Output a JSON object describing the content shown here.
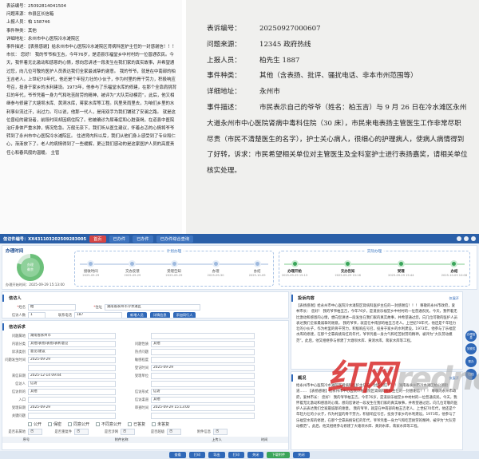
{
  "doc1": {
    "lines": [
      {
        "k": "表诉编号：",
        "v": "25092814041504"
      },
      {
        "k": "问题来源：",
        "v": "市县区长信箱"
      },
      {
        "k": "上报人员：",
        "v": "柏        158746"
      },
      {
        "k": "事件种类：",
        "v": "其他"
      },
      {
        "k": "详细地址：",
        "v": "永州市中心医院冷水滩院区"
      },
      {
        "k": "事件描述：",
        "v": "【表扬感谢】给永州市中心医院冷水滩院区肾病科医护主任的一封感谢信！！！  尊敬的永州市政府，爱林"
      }
    ],
    "body": "市长：   您好！   我的爷爷柏玉吉，今年76岁，是道县乐福堂乡中村村的一位普通农民。今天，我怀着无比激动和感恩的心情，想向您讲述一段发生在我们家的真实故事，并希望通过您，向几位可敬的医护人员表达我们全家最诚挚的谢意。   我的爷爷，就是在中南部的柏玉吉老人。上世纪70年代，他还是个年轻力壮的小伙子，作为村里的骨干劳力，积极响应号召，投身于家乡的水利建设。1973年，他参与了乐福堂水库的修建，在那个全靠肩挑背扛的年代，爷爷凭着一身力气和吃苦耐劳的精神，被评为“大队劳动模范”。此后，他又相继参与修建了大塘坝水库、黄洞水库，蒋家水库等工程。风里来雨里去，为咱们乡里的水利事业流过汗，出过力。可以说，他那一代人，是用双手为我们铺就了安澜之路。   就是这位曾经的建设者，前段时间却因病住院了。他被确诊为尿毒症和心脏衰竭，在道县中医院治疗身体严重水肿，情况危急。万般无奈下，我们听从医生建议，怀着忐忑的心情将爷爷转到了永州市中心医院冷水滩院区。   住进肾内科以后，我们从他们身上感受到了专业和仁心，渐渐放下了。老人的病情得到了一些缓解，更让我们感动的是这家医护人员的高度责任心和春风般的温暖。   主管"
  },
  "doc2": {
    "rows": [
      {
        "k": "表诉编号：",
        "v": "20250927000607"
      },
      {
        "k": "问题来源：",
        "v": "12345 政府热线"
      },
      {
        "k": "上报人员：",
        "v": "柏先生  1887"
      },
      {
        "k": "事件种类：",
        "v": "其他（含表扬、批评、骚扰电话、非本市州范围等）"
      },
      {
        "k": "详细地址：",
        "v": "永州市"
      }
    ],
    "desc_k": "事件描述：",
    "desc_v": "市民表示自己的爷爷（姓名：柏玉吉）与 9 月 26 日在冷水滩区永州大道永州市中心医院肾病中毒科住院（30 床），市民来电表扬主管医生工作非常尽职尽责（市民不清楚医生的名字），护士关心病人，很细心的护理病人，使病人病情得到了好转，诉求：市民希望相关单位对主管医生及全科室护士进行表扬嘉奖，请相关单位核实处理。"
  },
  "app": {
    "title": "信访件编号：XX431103202509283005",
    "tabs": [
      "首页",
      "已办件",
      "已办件",
      "已办件综合查询"
    ],
    "progress": {
      "title": "办理时间",
      "ring_line1": "办理",
      "ring_line2": "剩余",
      "start_label": "办理开始时间：2025-09-29 15:13:00",
      "plan_label": "计划办理",
      "actual_label": "实际办理",
      "plan_steps": [
        {
          "name": "接收时间",
          "time": "2025-09-29"
        },
        {
          "name": "交办反馈",
          "time": "2025-09-29"
        },
        {
          "name": "受理告知",
          "time": "2025-09-29"
        },
        {
          "name": "办理",
          "time": "2025-09-30"
        },
        {
          "name": "办结",
          "time": "2025-10-09"
        }
      ],
      "actual_steps": [
        {
          "name": "办理开始",
          "time": "2025-09-29 15:13"
        },
        {
          "name": "交办告知",
          "time": "2025-09-29 15:16"
        },
        {
          "name": "受理",
          "time": "2025-09-29 15:44"
        },
        {
          "name": "办结",
          "time": "2025-10-09 10:08"
        }
      ]
    },
    "person": {
      "title": "信访人",
      "name_label": "姓名",
      "name_value": "柏",
      "addr_label": "住址",
      "addr_value": "湖南省永州市冷水滩区",
      "count_label": "信访人数",
      "count_value": "1",
      "id_label": "身份证号码",
      "phone_label": "联系电话",
      "phone_value": "187",
      "btn1": "新增人员",
      "btn2": "详情信息",
      "btn3": "添加同行人"
    },
    "request": {
      "title": "信访诉求",
      "rows": [
        {
          "l": "问题属地",
          "v": "湖南省永州市",
          "l2": "",
          "v2": ""
        },
        {
          "l": "内容分类",
          "v": "其他/表扬/表扬/表彰意见",
          "l2": "问题性质",
          "v2": "其他"
        },
        {
          "l": "诉求类别",
          "v": "意见/建议",
          "l2": "热点问题",
          "v2": ""
        },
        {
          "l": "问题发生时间",
          "v": "2025-09-29",
          "l2": "敏感程度",
          "v2": ""
        },
        {
          "l": "",
          "v": "",
          "l2": "登记时间",
          "v2": "2025-09-29"
        },
        {
          "l": "来信日期",
          "v": "2025-12-14 09:44",
          "l2": "受理单位",
          "v2": ""
        },
        {
          "l": "信访人",
          "v": "信访",
          "l2": "",
          "v2": ""
        },
        {
          "l": "信访目的",
          "v": "其他",
          "l2": "信访形式",
          "v2": "信访"
        },
        {
          "l": "入口",
          "v": "",
          "l2": "信访渠道",
          "v2": "其他"
        },
        {
          "l": "受理日期",
          "v": "2025-09-29",
          "l2": "审查时间",
          "v2": "2025-09-29 15:13:00"
        },
        {
          "l": "关键问题",
          "v": "",
          "l2": "",
          "v2": ""
        }
      ],
      "checks": [
        "公开",
        "保密",
        "同意公开",
        "不同意公开",
        "已答复",
        "未答复"
      ],
      "yes_no": "否",
      "extra_labels": [
        "是否非属地",
        "是否重复件",
        "是否涉网",
        "是否越级",
        "附件信息"
      ],
      "attach_headers": [
        "序号",
        "附件名称",
        "上传人",
        "时间"
      ]
    },
    "content": {
      "title": "投诉内容",
      "btn_view": "仅展开",
      "text": "【表扬感谢】给永州市中心医院冷水滩院区肾病科医护主任的一封感谢信！！！ 尊敬的永州市政府，爱林市长：   您好！   我的爷爷柏玉吉，今年76岁，是道县乐福堂乡中村村的一位普通农民。今天，我怀着无比激动和感恩的心情，想向您讲述一段发生在我们家的真实故事，并希望通过您，向几位可敬的医护人员表达我们全家最诚挚的谢意。   我的爷爷，就是在中南部的柏玉吉老人。上世纪70年代，他还是个年轻力壮的小伙子，作为村里的骨干劳力，积极响应号召，投身于家乡的水利建设。1973年，他参与了乐福堂水库的修建，在那个全靠肩挑背扛的年代，爷爷凭着一身力气和吃苦耐劳的精神，被评为“大队劳动模范”。此后，他又相继参与修建了大塘坝水库、黄洞水库，蒋家水库等工程。"
    },
    "summary": {
      "title": "概况",
      "btn_view": "仅展开",
      "text": "给永州市中心医院冷水滩院区肾病科医护主任的一封感谢信！！！ 湖南省永州市冷水滩区柏公湖街道…… 【表扬感谢】给永州市中心医院冷水滩院区肾病科医护主任的一封感谢信！！！ 尊敬的永州市政府，爱林市长：   您好！   我的爷爷柏玉吉，今年76岁，是道县乐福堂乡中村村的一位普通农民。今天，我怀着无比激动和感恩的心情，想向您讲述一段发生在我们家的真实故事，并希望通过您，向几位可敬的医护人员表达我们全家最诚挚的谢意。   我的爷爷，就是在中南部的柏玉吉老人。上世纪70年代，他还是个年轻力壮的小伙子，作为村里的骨干劳力，积极响应号召，投身于家乡的水利建设。1973年，他参与了乐福堂水库的修建，在那个全靠肩挑背扛的年代，爷爷凭着一身力气和吃苦耐劳的精神，被评为“大队劳动模范”。此后，他又相继参与修建了大塘坝水库、黄洞水库，蒋家水库等工程。"
    },
    "side_buttons": [
      "办理信息",
      "关联件",
      "督办",
      "归档"
    ],
    "bottom_buttons": [
      "查看",
      "打印",
      "导出",
      "打印",
      "关闭",
      "下载附件",
      "关闭"
    ]
  },
  "watermark": {
    "cn": "红网",
    "en": "rednet"
  },
  "colors": {
    "title_blue": "#2a5fa8",
    "accent_red": "#d64545",
    "step_green": "#3aa55a",
    "watermark_red": "#d72323"
  }
}
